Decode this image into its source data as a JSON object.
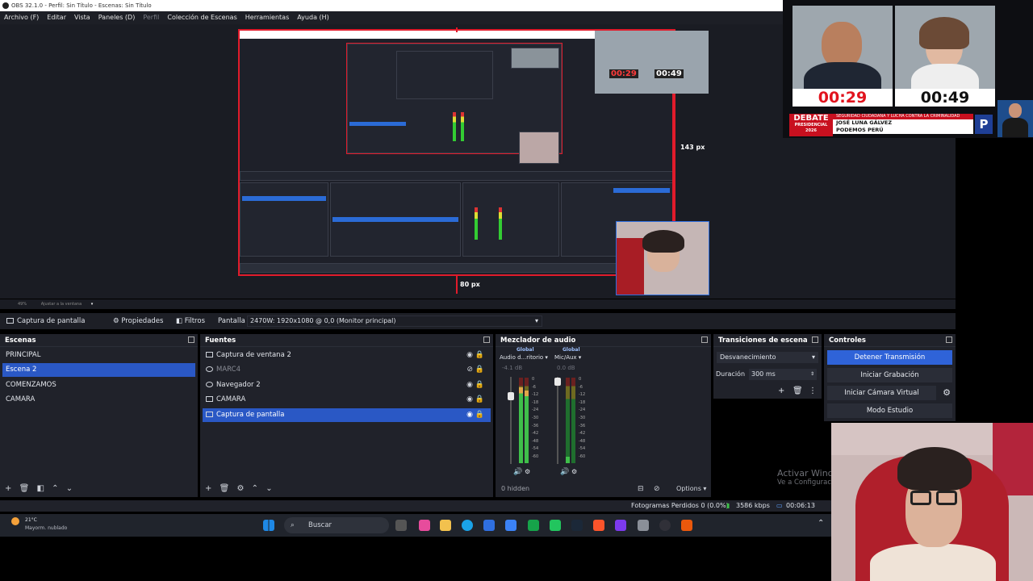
{
  "window": {
    "title": "OBS 32.1.0 - Perfil: Sin Título - Escenas: Sin Título"
  },
  "menu": {
    "items": [
      "Archivo (F)",
      "Editar",
      "Vista",
      "Paneles (D)",
      "Perfil",
      "Colección de Escenas",
      "Herramientas",
      "Ayuda (H)"
    ]
  },
  "preview": {
    "dim_height": "143 px",
    "dim_width": "80 px",
    "zoom_label": "49%",
    "fit_label": "Ajustar a la ventana",
    "thumb_timer_left": "00:29",
    "thumb_timer_right": "00:49"
  },
  "source_toolbar": {
    "source_name": "Captura de pantalla",
    "properties_label": "Propiedades",
    "filters_label": "Filtros",
    "display_label": "Pantalla",
    "display_value": "2470W: 1920x1080 @ 0,0 (Monitor principal)"
  },
  "scenes": {
    "title": "Escenas",
    "items": [
      "PRINCIPAL",
      "Escena 2",
      "COMENZAMOS",
      "CAMARA"
    ],
    "selected_index": 1
  },
  "sources": {
    "title": "Fuentes",
    "items": [
      "Captura de ventana 2",
      "MARC4",
      "Navegador 2",
      "CAMARA",
      "Captura de pantalla"
    ],
    "selected_index": 4
  },
  "mixer": {
    "title": "Mezclador de audio",
    "ch1_tag": "Global",
    "ch1_name": "Audio d...ritorio",
    "ch1_db": "-4.1 dB",
    "ch2_tag": "Global",
    "ch2_name": "Mic/Aux",
    "ch2_db": "0.0 dB",
    "hidden_label": "0 hidden",
    "options_label": "Options",
    "scale": [
      "0",
      "-6",
      "-12",
      "-18",
      "-24",
      "-30",
      "-36",
      "-42",
      "-48",
      "-54",
      "-60"
    ]
  },
  "transitions": {
    "title": "Transiciones de escena",
    "transition": "Desvanecimiento",
    "duration_label": "Duración",
    "duration_value": "300 ms"
  },
  "controls": {
    "title": "Controles",
    "stop_stream": "Detener Transmisión",
    "start_record": "Iniciar Grabación",
    "virtual_cam": "Iniciar Cámara Virtual",
    "studio_mode": "Modo Estudio"
  },
  "statusbar": {
    "dropped_frames": "Fotogramas Perdidos 0 (0.0%)",
    "bitrate": "3586 kbps",
    "time": "00:06:13"
  },
  "taskbar": {
    "weather_temp": "21°C",
    "weather_desc": "Mayorm. nublado",
    "search_placeholder": "Buscar"
  },
  "overlay": {
    "timer_left": "00:29",
    "timer_right": "00:49",
    "brand": "DEBATE",
    "brand_sub": "PRESIDENCIAL",
    "brand_year": "2026",
    "headline": "SEGURIDAD CIUDADANA Y LUCHA CONTRA LA CRIMINALIDAD",
    "speaker": "JOSÉ LUNA GÁLVEZ",
    "party": "PODEMOS PERÚ",
    "party_logo": "P"
  },
  "watermark": {
    "line1": "Activar Windows",
    "line2": "Ve a Configuración"
  }
}
